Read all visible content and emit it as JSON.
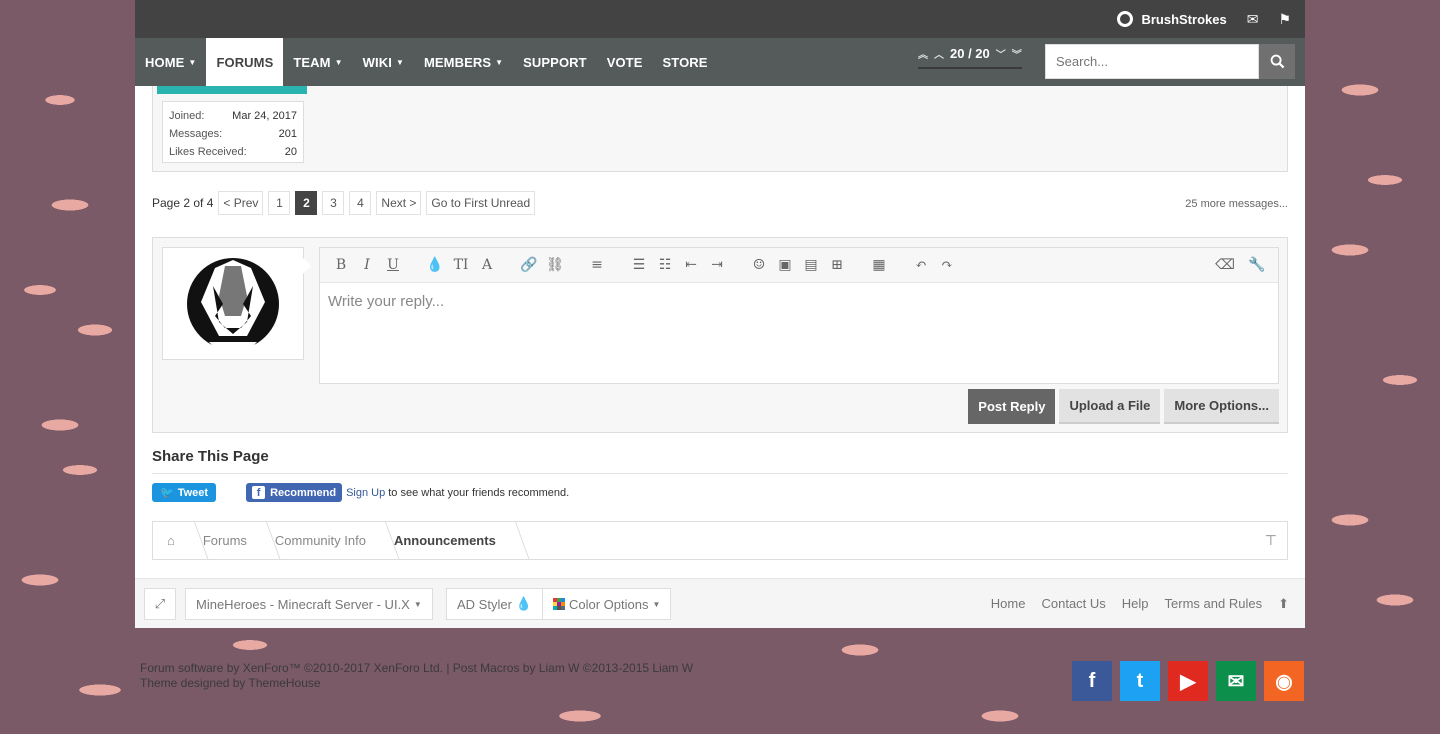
{
  "topbar": {
    "brand": "BrushStrokes",
    "icons": [
      "envelope-icon",
      "flag-icon"
    ]
  },
  "nav": {
    "items": [
      {
        "label": "HOME",
        "caret": true
      },
      {
        "label": "FORUMS",
        "caret": false,
        "active": true
      },
      {
        "label": "TEAM",
        "caret": true
      },
      {
        "label": "WIKI",
        "caret": true
      },
      {
        "label": "MEMBERS",
        "caret": true
      },
      {
        "label": "SUPPORT",
        "caret": false
      },
      {
        "label": "VOTE",
        "caret": false
      },
      {
        "label": "STORE",
        "caret": false
      }
    ],
    "pager": "20 / 20",
    "search_placeholder": "Search..."
  },
  "post_user": {
    "rows": [
      {
        "label": "Joined:",
        "value": "Mar 24, 2017"
      },
      {
        "label": "Messages:",
        "value": "201"
      },
      {
        "label": "Likes Received:",
        "value": "20"
      }
    ]
  },
  "pagination": {
    "label": "Page 2 of 4",
    "prev": "< Prev",
    "pages": [
      "1",
      "2",
      "3",
      "4"
    ],
    "current": "2",
    "next": "Next >",
    "first_unread": "Go to First Unread",
    "more": "25 more messages..."
  },
  "reply": {
    "placeholder": "Write your reply...",
    "post_button": "Post Reply",
    "upload_button": "Upload a File",
    "more_button": "More Options..."
  },
  "share": {
    "title": "Share This Page",
    "tweet": "Tweet",
    "recommend": "Recommend",
    "signup": "Sign Up",
    "signup_text": "to see what your friends recommend."
  },
  "breadcrumb": [
    "Forums",
    "Community Info",
    "Announcements"
  ],
  "footer": {
    "style_chooser": "MineHeroes - Minecraft Server - UI.X",
    "ad_styler": "AD Styler",
    "color_options": "Color Options",
    "links": [
      "Home",
      "Contact Us",
      "Help",
      "Terms and Rules"
    ]
  },
  "copyright": {
    "line1": "Forum software by XenForo™ ©2010-2017 XenForo Ltd. | Post Macros by Liam W ©2013-2015 Liam W",
    "line2_prefix": "Theme designed by",
    "line2_link": "ThemeHouse"
  },
  "colors": {
    "accent_teal": "#2ab4b0",
    "nav_bg": "#555b5b",
    "topbar_bg": "#434343",
    "facebook": "#3b5998",
    "twitter": "#1da1f2",
    "youtube": "#e02a20",
    "email": "#0c8f4a",
    "rss": "#f26522"
  }
}
